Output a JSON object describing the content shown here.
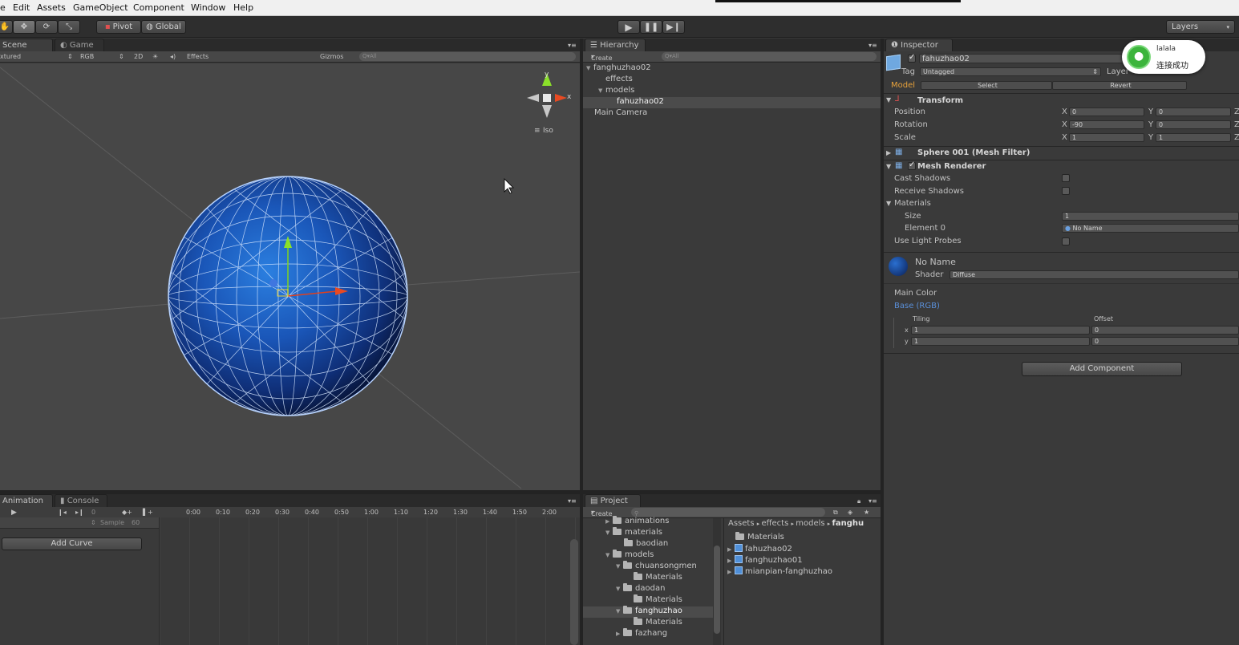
{
  "menu": [
    "e",
    "Edit",
    "Assets",
    "GameObject",
    "Component",
    "Window",
    "Help"
  ],
  "toolbar": {
    "pivot_label": "Pivot",
    "global_label": "Global",
    "layers_label": "Layers"
  },
  "scene": {
    "tab_scene": "Scene",
    "tab_game": "Game",
    "shading_mode": "xtured",
    "render_mode": "RGB",
    "mode_2d": "2D",
    "effects_label": "Effects",
    "gizmos_label": "Gizmos",
    "search_placeholder": "Q▾All",
    "gizmo_y": "y",
    "gizmo_x": "x",
    "iso_label": "Iso"
  },
  "hierarchy": {
    "tab_label": "Hierarchy",
    "create_label": "Create",
    "search_placeholder": "Q▾All",
    "items": [
      {
        "label": "fanghuzhao02",
        "depth": 0,
        "expanded": true,
        "selected": false
      },
      {
        "label": "effects",
        "depth": 1,
        "expanded": false,
        "selected": false
      },
      {
        "label": "models",
        "depth": 1,
        "expanded": true,
        "selected": false
      },
      {
        "label": "fahuzhao02",
        "depth": 2,
        "expanded": false,
        "selected": true
      },
      {
        "label": "Main Camera",
        "depth": 0,
        "expanded": false,
        "selected": false
      }
    ]
  },
  "inspector": {
    "tab_label": "Inspector",
    "object_name": "fahuzhao02",
    "tag_label": "Tag",
    "tag_value": "Untagged",
    "layer_label": "Layer",
    "model_label": "Model",
    "select_label": "Select",
    "revert_label": "Revert",
    "transform": {
      "title": "Transform",
      "position_label": "Position",
      "rotation_label": "Rotation",
      "scale_label": "Scale",
      "position": {
        "x": "0",
        "y": "0"
      },
      "rotation": {
        "x": "-90",
        "y": "0"
      },
      "scale": {
        "x": "1",
        "y": "1"
      },
      "axis_x": "X",
      "axis_y": "Y",
      "axis_z": "Z"
    },
    "mesh_filter_title": "Sphere 001 (Mesh Filter)",
    "mesh_renderer": {
      "title": "Mesh Renderer",
      "cast_shadows": "Cast Shadows",
      "receive_shadows": "Receive Shadows",
      "materials": "Materials",
      "size_label": "Size",
      "size_value": "1",
      "element0_label": "Element 0",
      "element0_value": "No Name",
      "use_light_probes": "Use Light Probes"
    },
    "material": {
      "name": "No Name",
      "shader_label": "Shader",
      "shader_value": "Diffuse",
      "main_color": "Main Color",
      "base_rgb": "Base (RGB)",
      "tiling_label": "Tiling",
      "offset_label": "Offset",
      "x_label": "x",
      "y_label": "y",
      "tiling_x": "1",
      "tiling_y": "1",
      "offset_x": "0",
      "offset_y": "0"
    },
    "add_component": "Add Component"
  },
  "notification": {
    "name": "lalala",
    "message": "连接成功"
  },
  "animation": {
    "tab_animation": "Animation",
    "tab_console": "Console",
    "frame_value": "0",
    "sample_label": "Sample",
    "sample_value": "60",
    "add_curve": "Add Curve",
    "timeline": [
      "0:00",
      "0:10",
      "0:20",
      "0:30",
      "0:40",
      "0:50",
      "1:00",
      "1:10",
      "1:20",
      "1:30",
      "1:40",
      "1:50",
      "2:00"
    ]
  },
  "project": {
    "tab_label": "Project",
    "create_label": "Create",
    "breadcrumb": [
      "Assets",
      "effects",
      "models",
      "fanghu"
    ],
    "tree": [
      {
        "label": "animations",
        "depth": 1,
        "arrow": "right"
      },
      {
        "label": "materials",
        "depth": 1,
        "arrow": "down"
      },
      {
        "label": "baodian",
        "depth": 2,
        "arrow": "none"
      },
      {
        "label": "models",
        "depth": 1,
        "arrow": "down"
      },
      {
        "label": "chuansongmen",
        "depth": 2,
        "arrow": "down"
      },
      {
        "label": "Materials",
        "depth": 3,
        "arrow": "none"
      },
      {
        "label": "daodan",
        "depth": 2,
        "arrow": "down"
      },
      {
        "label": "Materials",
        "depth": 3,
        "arrow": "none"
      },
      {
        "label": "fanghuzhao",
        "depth": 2,
        "arrow": "down"
      },
      {
        "label": "Materials",
        "depth": 3,
        "arrow": "none"
      },
      {
        "label": "fazhang",
        "depth": 2,
        "arrow": "right"
      }
    ],
    "assets": [
      {
        "label": "Materials",
        "kind": "folder"
      },
      {
        "label": "fahuzhao02",
        "kind": "model"
      },
      {
        "label": "fanghuzhao01",
        "kind": "model"
      },
      {
        "label": "mianpian-fanghuzhao",
        "kind": "model"
      }
    ]
  },
  "colors": {
    "accent_model": "#e8a23a",
    "link_blue": "#5a8fd8",
    "selection": "#4b4b4b",
    "notif_green": "#3cb43c"
  }
}
